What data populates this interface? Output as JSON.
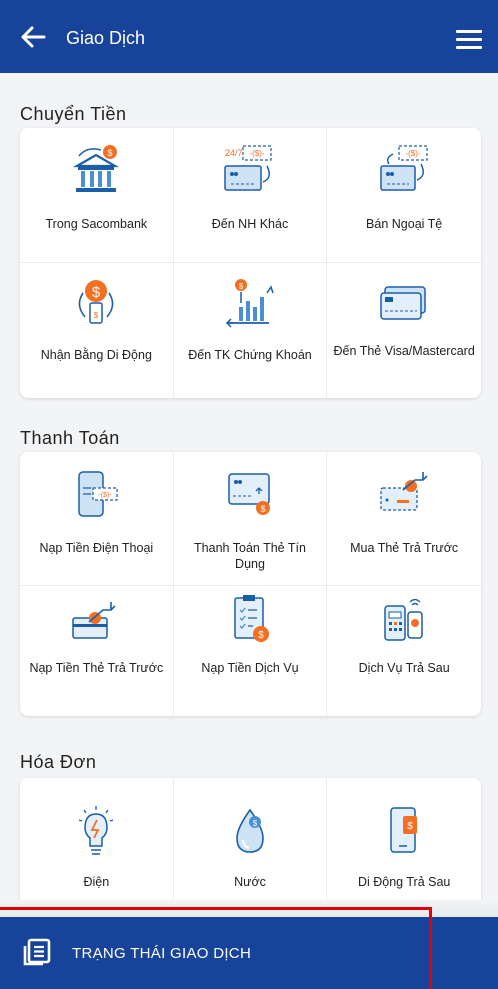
{
  "header": {
    "title": "Giao Dịch"
  },
  "sections": {
    "transfer": {
      "title": "Chuyển Tiền",
      "items": [
        {
          "label": "Trong Sacombank",
          "icon": "bank-transfer-icon"
        },
        {
          "label": "Đến NH Khác",
          "icon": "interbank-card-icon"
        },
        {
          "label": "Bán Ngoại Tệ",
          "icon": "foreign-currency-icon"
        },
        {
          "label": "Nhận Bằng Di Động",
          "icon": "mobile-receive-icon"
        },
        {
          "label": "Đến TK Chứng Khoán",
          "icon": "securities-account-icon"
        },
        {
          "label": "Đến Thẻ Visa/Mastercard",
          "icon": "visa-card-icon"
        }
      ]
    },
    "payment": {
      "title": "Thanh Toán",
      "items": [
        {
          "label": "Nạp Tiền Điện Thoại",
          "icon": "phone-topup-icon"
        },
        {
          "label": "Thanh Toán Thẻ Tín Dụng",
          "icon": "credit-card-payment-icon"
        },
        {
          "label": "Mua Thẻ Trả Trước",
          "icon": "prepaid-card-buy-icon"
        },
        {
          "label": "Nạp Tiền Thẻ Trả Trước",
          "icon": "prepaid-card-topup-icon"
        },
        {
          "label": "Nạp Tiền Dịch Vụ",
          "icon": "service-topup-icon"
        },
        {
          "label": "Dịch Vụ Trả Sau",
          "icon": "postpaid-service-icon"
        }
      ]
    },
    "bills": {
      "title": "Hóa Đơn",
      "items": [
        {
          "label": "Điện",
          "icon": "electricity-icon"
        },
        {
          "label": "Nước",
          "icon": "water-icon"
        },
        {
          "label": "Di Động Trả Sau",
          "icon": "mobile-postpaid-icon"
        }
      ]
    }
  },
  "bottom_bar": {
    "label": "TRẠNG THÁI GIAO DỊCH"
  },
  "colors": {
    "primary": "#17449a",
    "accent": "#f36f21",
    "icon_blue": "#4a8fd6",
    "highlight": "#e30000"
  }
}
